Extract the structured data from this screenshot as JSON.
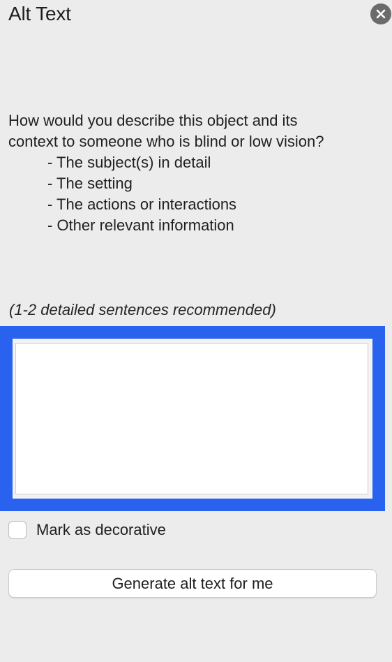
{
  "panel": {
    "title": "Alt Text",
    "close_icon": "close-circle-icon"
  },
  "description": {
    "line1": "How would you describe this object and its",
    "line2": "context to someone who is blind or low vision?",
    "bullets": [
      "- The subject(s) in detail",
      "- The setting",
      "- The actions or interactions",
      "- Other relevant information"
    ]
  },
  "hint": "(1-2 detailed sentences recommended)",
  "alt_text_input": {
    "value": "",
    "focus_color": "#2962ef"
  },
  "decorative": {
    "label": "Mark as decorative",
    "checked": false
  },
  "generate_button": {
    "label": "Generate alt text for me"
  }
}
